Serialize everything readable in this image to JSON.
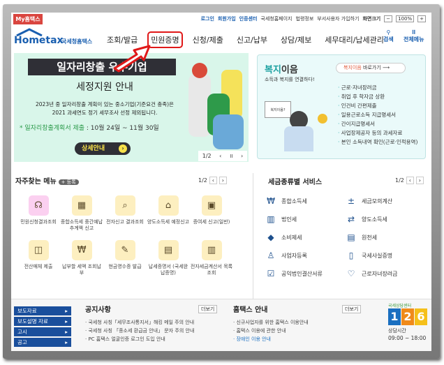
{
  "top": {
    "my_hometax": "My홈택스",
    "links": [
      "로그인",
      "회원가입",
      "인증센터"
    ],
    "sub_links": [
      "국세청홈페이지",
      "법령정보",
      "부서사용자 가입하기"
    ],
    "screen_size_label": "화면크기",
    "zoom": "100%"
  },
  "logo": {
    "text": "Hometax",
    "sub": "국세청홈택스"
  },
  "nav": [
    "조회/발급",
    "민원증명",
    "신청/제출",
    "신고/납부",
    "상담/제보",
    "세무대리/납세관리"
  ],
  "tools": {
    "search": "검색",
    "all_menu": "전체메뉴"
  },
  "banner": {
    "title": "일자리창출 우수기업",
    "subtitle": "세정지원 안내",
    "desc1": "2023년 중 일자리창출 계획이 있는 중소기업(기준요건 충족)은",
    "desc2": "2021 과세연도 정기 세무조사 선정 제외됩니다.",
    "period_label": "* 일자리창출계획서 제출",
    "period": " : 10월 24일 ~ 11월 30일",
    "button": "상세안내",
    "page": "1/2"
  },
  "welfare": {
    "title_a": "복지",
    "title_b": "이음",
    "tagline": "소득과 복지를 연결하다!",
    "go_a": "복지이음",
    "go_b": " 바로가기",
    "items": [
      "근로·자녀장려금",
      "취업 후 학자금 상환",
      "인건비 간편제출",
      "일용근로소득 지급명세서",
      "간이지급명세서",
      "사업장제공자 등의 과세자료",
      "본인 소득내역 확인(근로·인적용역)"
    ],
    "bubble": "복지이음?"
  },
  "freq": {
    "title": "자주찾는 메뉴",
    "register": "+ 등록",
    "page": "1/2",
    "items": [
      {
        "label": "민원신청결과조회",
        "icon": "headset"
      },
      {
        "label": "종합소득세 중간예납추계액 신고",
        "icon": "calendar"
      },
      {
        "label": "전자신고 결과조회",
        "icon": "search-doc"
      },
      {
        "label": "양도소득세 예정신고",
        "icon": "house"
      },
      {
        "label": "증여세 신고(일반)",
        "icon": "gift-doc"
      },
      {
        "label": "전산매체 제출",
        "icon": "media"
      },
      {
        "label": "납부할 세액 조회납부",
        "icon": "money-bag"
      },
      {
        "label": "현금영수증 발급",
        "icon": "receipt"
      },
      {
        "label": "납세증명서 (국세완납증명)",
        "icon": "certificate"
      },
      {
        "label": "전자세금계산서 목록조회",
        "icon": "invoice"
      }
    ]
  },
  "taxsvc": {
    "title": "세금종류별 서비스",
    "page": "1/2",
    "items": [
      {
        "label": "종합소득세",
        "icon": "money-bag"
      },
      {
        "label": "세금모의계산",
        "icon": "calculator"
      },
      {
        "label": "법인세",
        "icon": "building"
      },
      {
        "label": "양도소득세",
        "icon": "transfer"
      },
      {
        "label": "소비제세",
        "icon": "diamond"
      },
      {
        "label": "원천세",
        "icon": "document"
      },
      {
        "label": "사업자등록",
        "icon": "person"
      },
      {
        "label": "국세사실증명",
        "icon": "file"
      },
      {
        "label": "공익법인결산서류",
        "icon": "clipboard"
      },
      {
        "label": "근로자녀장려금",
        "icon": "heart"
      }
    ]
  },
  "side_buttons": [
    "보도자료",
    "보도설명 자료",
    "고시",
    "공고"
  ],
  "notice": {
    "title": "공지사항",
    "more": "더보기",
    "items": [
      "국세청 사칭「세무조사통지서」해킹 메일 주의 안내",
      "국세청 사칭 「종소세 환급금 안내」 문자 주의 안내",
      "PC 홈택스 얼굴인증 로그인 도입 안내"
    ]
  },
  "guide": {
    "title": "홈택스 안내",
    "more": "더보기",
    "items": [
      "신규사업자를 위한 홈택스 이용안내",
      "홈택스 이용에 관한 안내",
      "장애인 이용 안내"
    ]
  },
  "callcenter": {
    "title": "국세상담센터",
    "number": "126",
    "hours_label": "상담시간",
    "hours": "09:00 ~ 18:00"
  }
}
